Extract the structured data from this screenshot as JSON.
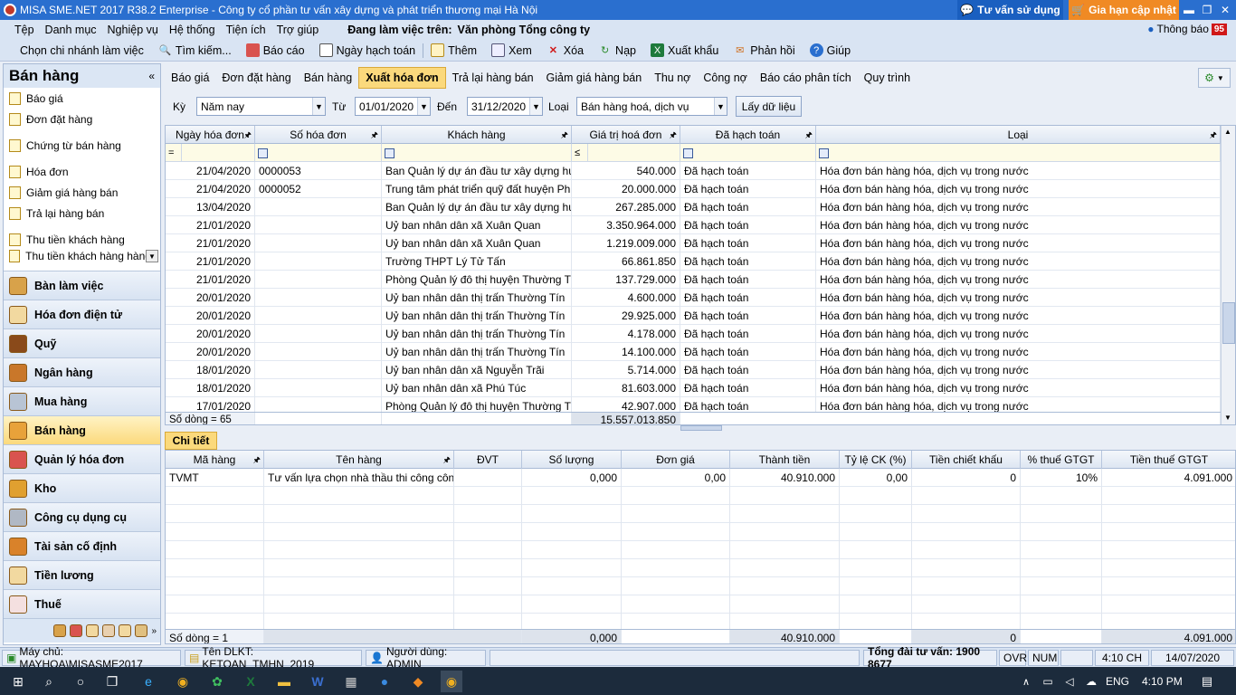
{
  "window": {
    "title": "MISA SME.NET 2017 R38.2 Enterprise - Công ty cổ phần tư vấn xây dựng và phát triển thương mại Hà Nội",
    "tu_van": "Tư vấn sử dụng",
    "gia_han": "Gia hạn cập nhật"
  },
  "menu": {
    "items": [
      "Tệp",
      "Danh mục",
      "Nghiệp vụ",
      "Hệ thống",
      "Tiện ích",
      "Trợ giúp"
    ],
    "working_label": "Đang làm việc trên:",
    "working_value": "Văn phòng Tổng công ty",
    "notif_label": "Thông báo",
    "notif_count": "95"
  },
  "toolbar": {
    "chon_chi_nhanh": "Chọn chi nhánh làm việc",
    "tim_kiem": "Tìm kiếm...",
    "bao_cao": "Báo cáo",
    "ngay_hach_toan": "Ngày hạch toán",
    "them": "Thêm",
    "xem": "Xem",
    "xoa": "Xóa",
    "nap": "Nạp",
    "xuat_khau": "Xuất khẩu",
    "phan_hoi": "Phản hồi",
    "giup": "Giúp"
  },
  "sidebar": {
    "title": "Bán hàng",
    "items": [
      "Báo giá",
      "Đơn đặt hàng",
      "Chứng từ bán hàng",
      "Hóa đơn",
      "Giảm giá hàng bán",
      "Trả lại hàng bán",
      "Thu tiền khách hàng",
      "Thu tiền khách hàng hàng loạt"
    ],
    "nav": [
      "Bàn làm việc",
      "Hóa đơn điện tử",
      "Quỹ",
      "Ngân hàng",
      "Mua hàng",
      "Bán hàng",
      "Quản lý hóa đơn",
      "Kho",
      "Công cụ dụng cụ",
      "Tài sản cố định",
      "Tiền lương",
      "Thuế"
    ]
  },
  "tabs": [
    "Báo giá",
    "Đơn đặt hàng",
    "Bán hàng",
    "Xuất hóa đơn",
    "Trả lại hàng bán",
    "Giảm giá hàng bán",
    "Thu nợ",
    "Công nợ",
    "Báo cáo phân tích",
    "Quy trình"
  ],
  "filters": {
    "ky_label": "Kỳ",
    "ky_value": "Năm nay",
    "tu_label": "Từ",
    "tu_value": "01/01/2020",
    "den_label": "Đến",
    "den_value": "31/12/2020",
    "loai_label": "Loại",
    "loai_value": "Bán hàng hoá, dịch vụ",
    "load_btn": "Lấy dữ liệu"
  },
  "grid": {
    "headers": [
      "Ngày hóa đơn",
      "Số hóa đơn",
      "Khách hàng",
      "Giá trị hoá đơn",
      "Đã hạch toán",
      "Loại"
    ],
    "filter_ops": [
      "=",
      "≤"
    ],
    "rows": [
      [
        "21/04/2020",
        "0000053",
        "Ban Quản lý dự án đầu tư xây dựng hu...",
        "540.000",
        "Đã hạch toán",
        "Hóa đơn bán hàng hóa, dịch vụ trong nước"
      ],
      [
        "21/04/2020",
        "0000052",
        "Trung tâm phát triển quỹ đất huyện Ph...",
        "20.000.000",
        "Đã hạch toán",
        "Hóa đơn bán hàng hóa, dịch vụ trong nước"
      ],
      [
        "13/04/2020",
        "",
        "Ban Quản lý dự án đầu tư xây dựng hu...",
        "267.285.000",
        "Đã hạch toán",
        "Hóa đơn bán hàng hóa, dịch vụ trong nước"
      ],
      [
        "21/01/2020",
        "",
        "Uỷ ban nhân dân xã Xuân Quan",
        "3.350.964.000",
        "Đã hạch toán",
        "Hóa đơn bán hàng hóa, dịch vụ trong nước"
      ],
      [
        "21/01/2020",
        "",
        "Uỷ ban nhân dân xã Xuân Quan",
        "1.219.009.000",
        "Đã hạch toán",
        "Hóa đơn bán hàng hóa, dịch vụ trong nước"
      ],
      [
        "21/01/2020",
        "",
        "Trường THPT Lý Tử Tấn",
        "66.861.850",
        "Đã hạch toán",
        "Hóa đơn bán hàng hóa, dịch vụ trong nước"
      ],
      [
        "21/01/2020",
        "",
        "Phòng Quản lý đô thị huyện Thường Tín",
        "137.729.000",
        "Đã hạch toán",
        "Hóa đơn bán hàng hóa, dịch vụ trong nước"
      ],
      [
        "20/01/2020",
        "",
        "Uỷ ban nhân dân thị trấn Thường Tín",
        "4.600.000",
        "Đã hạch toán",
        "Hóa đơn bán hàng hóa, dịch vụ trong nước"
      ],
      [
        "20/01/2020",
        "",
        "Uỷ ban nhân dân thị trấn Thường Tín",
        "29.925.000",
        "Đã hạch toán",
        "Hóa đơn bán hàng hóa, dịch vụ trong nước"
      ],
      [
        "20/01/2020",
        "",
        "Uỷ ban nhân dân thị trấn Thường Tín",
        "4.178.000",
        "Đã hạch toán",
        "Hóa đơn bán hàng hóa, dịch vụ trong nước"
      ],
      [
        "20/01/2020",
        "",
        "Uỷ ban nhân dân thị trấn Thường Tín",
        "14.100.000",
        "Đã hạch toán",
        "Hóa đơn bán hàng hóa, dịch vụ trong nước"
      ],
      [
        "18/01/2020",
        "",
        "Uỷ ban nhân dân xã Nguyễn Trãi",
        "5.714.000",
        "Đã hạch toán",
        "Hóa đơn bán hàng hóa, dịch vụ trong nước"
      ],
      [
        "18/01/2020",
        "",
        "Uỷ ban nhân dân xã Phú Túc",
        "81.603.000",
        "Đã hạch toán",
        "Hóa đơn bán hàng hóa, dịch vụ trong nước"
      ],
      [
        "17/01/2020",
        "",
        "Phòng Quản lý đô thị huyện Thường Tín",
        "42.907.000",
        "Đã hạch toán",
        "Hóa đơn bán hàng hóa, dịch vụ trong nước"
      ]
    ],
    "footer_count": "Số dòng = 65",
    "footer_total": "15.557.013.850"
  },
  "detail": {
    "tab": "Chi tiết",
    "headers": [
      "Mã hàng",
      "Tên hàng",
      "ĐVT",
      "Số lượng",
      "Đơn giá",
      "Thành tiền",
      "Tỷ lệ CK (%)",
      "Tiền chiết khấu",
      "% thuế GTGT",
      "Tiền thuế GTGT"
    ],
    "rows": [
      [
        "TVMT",
        "Tư vấn lựa chọn nhà thầu thi công công",
        "",
        "0,000",
        "0,00",
        "40.910.000",
        "0,00",
        "0",
        "10%",
        "4.091.000"
      ]
    ],
    "footer": {
      "count": "Số dòng = 1",
      "qty": "0,000",
      "amount": "40.910.000",
      "discount": "0",
      "tax": "4.091.000"
    }
  },
  "status": {
    "server": "Máy chủ: MAYHOA\\MISASME2017",
    "db": "Tên DLKT: KETOAN_TMHN_2019",
    "user": "Người dùng: ADMIN",
    "hotline": "Tổng đài tư vấn: 1900 8677",
    "ovr": "OVR",
    "num": "NUM",
    "time": "4:10 CH",
    "date": "14/07/2020"
  },
  "taskbar": {
    "lang": "ENG",
    "time": "4:10 PM"
  }
}
